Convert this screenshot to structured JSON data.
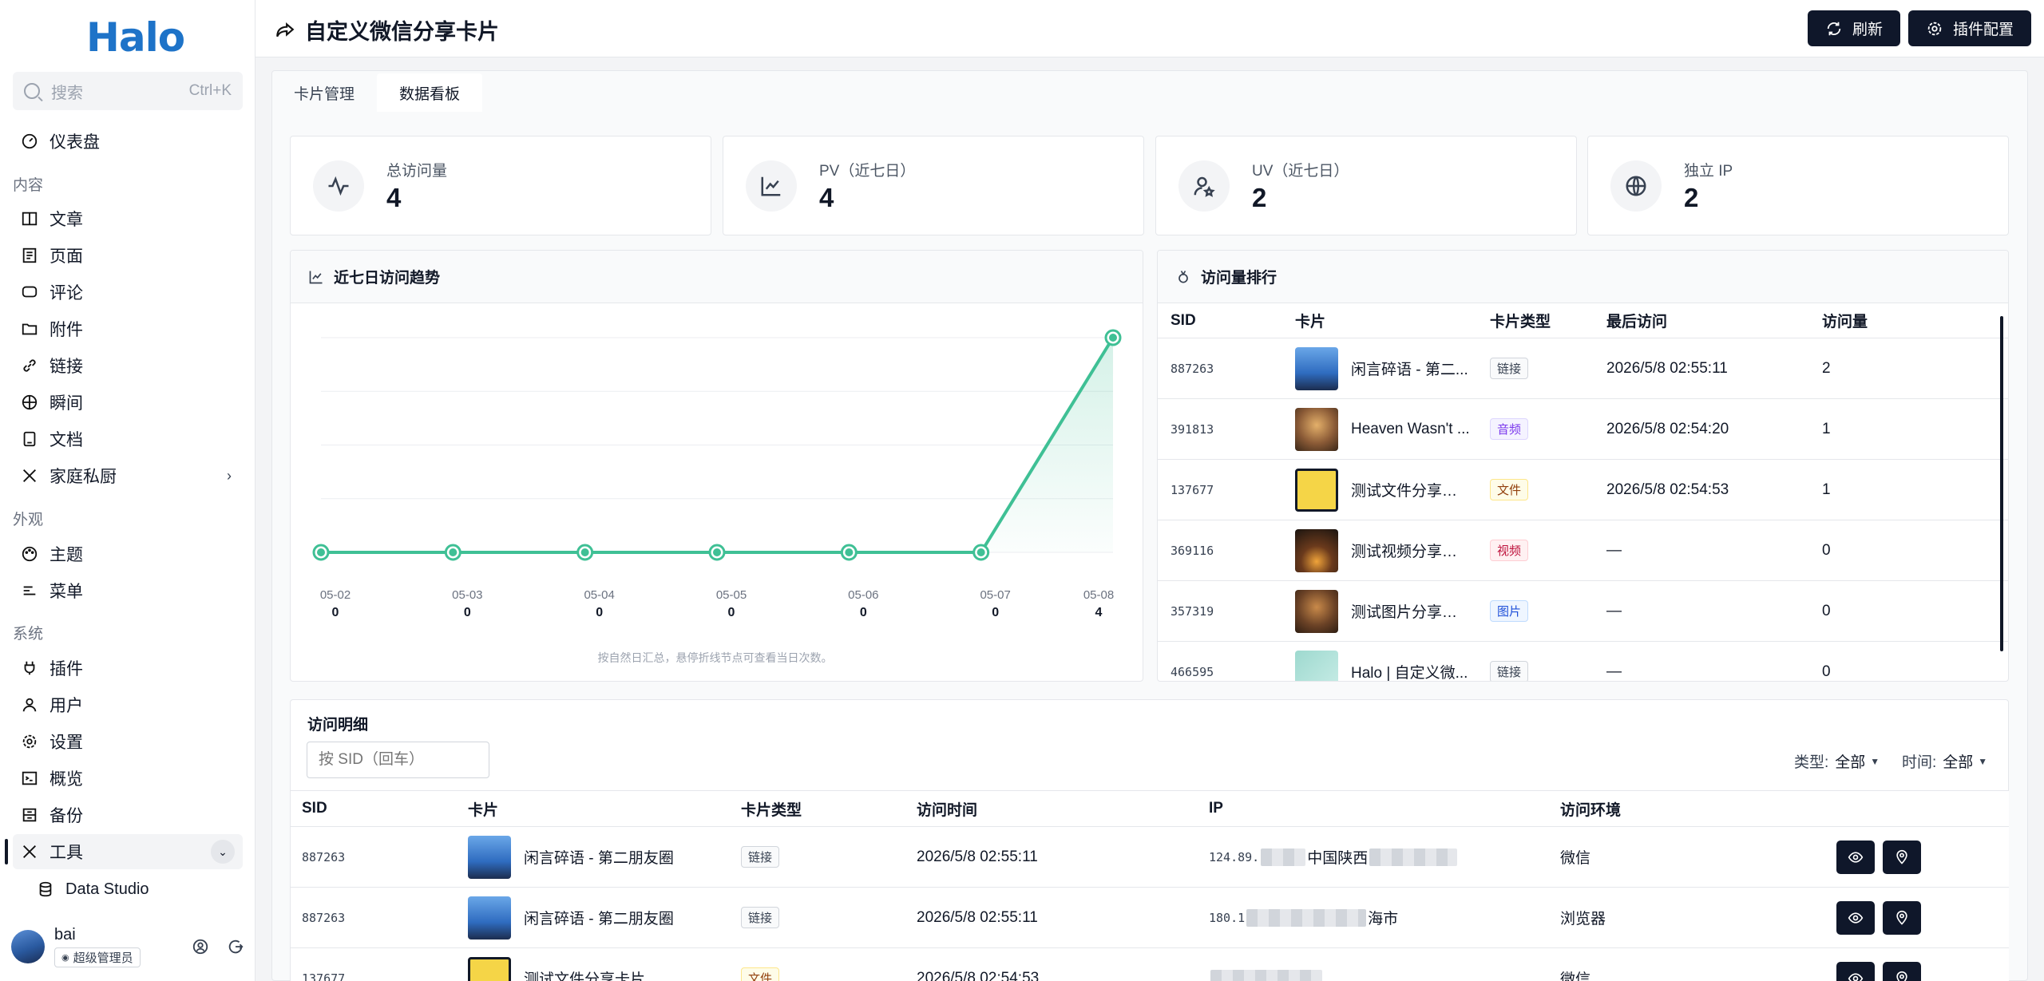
{
  "sidebar": {
    "logo": "Halo",
    "search": {
      "placeholder": "搜索",
      "shortcut": "Ctrl+K"
    },
    "dashboard": "仪表盘",
    "group_content": "内容",
    "posts": "文章",
    "pages": "页面",
    "comments": "评论",
    "attachments": "附件",
    "links": "链接",
    "moments": "瞬间",
    "docs": "文档",
    "kitchen": "家庭私厨",
    "group_appearance": "外观",
    "themes": "主题",
    "menus": "菜单",
    "group_system": "系统",
    "plugins": "插件",
    "users": "用户",
    "settings": "设置",
    "overview": "概览",
    "backup": "备份",
    "tools": "工具",
    "data_studio": "Data Studio",
    "user": {
      "name": "bai",
      "role": "超级管理员"
    }
  },
  "header": {
    "title": "自定义微信分享卡片",
    "refresh": "刷新",
    "plugin_config": "插件配置"
  },
  "tabs": {
    "manage": "卡片管理",
    "dashboard": "数据看板"
  },
  "stats": [
    {
      "label": "总访问量",
      "value": "4",
      "icon": "activity-icon"
    },
    {
      "label": "PV（近七日）",
      "value": "4",
      "icon": "line-chart-icon"
    },
    {
      "label": "UV（近七日）",
      "value": "2",
      "icon": "user-star-icon"
    },
    {
      "label": "独立 IP",
      "value": "2",
      "icon": "globe-icon"
    }
  ],
  "trend": {
    "title": "近七日访问趋势",
    "note": "按自然日汇总，悬停折线节点可查看当日次数。",
    "accent": "#3fc095"
  },
  "chart_data": {
    "type": "area",
    "categories": [
      "05-02",
      "05-03",
      "05-04",
      "05-05",
      "05-06",
      "05-07",
      "05-08"
    ],
    "values": [
      0,
      0,
      0,
      0,
      0,
      0,
      4
    ],
    "ylim": [
      0,
      4
    ],
    "grid": true,
    "color": "#3fc095"
  },
  "ranking": {
    "title": "访问量排行",
    "headers": [
      "SID",
      "卡片",
      "卡片类型",
      "最后访问",
      "访问量"
    ],
    "rows": [
      {
        "sid": "887263",
        "card": "闲言碎语 - 第二...",
        "type": "链接",
        "last": "2026/5/8 02:55:11",
        "count": "2"
      },
      {
        "sid": "391813",
        "card": "Heaven Wasn't ...",
        "type": "音频",
        "last": "2026/5/8 02:54:20",
        "count": "1"
      },
      {
        "sid": "137677",
        "card": "测试文件分享卡片",
        "type": "文件",
        "last": "2026/5/8 02:54:53",
        "count": "1"
      },
      {
        "sid": "369116",
        "card": "测试视频分享卡片",
        "type": "视频",
        "last": "—",
        "count": "0"
      },
      {
        "sid": "357319",
        "card": "测试图片分享卡片",
        "type": "图片",
        "last": "—",
        "count": "0"
      },
      {
        "sid": "466595",
        "card": "Halo | 自定义微...",
        "type": "链接",
        "last": "—",
        "count": "0"
      }
    ]
  },
  "detail": {
    "title": "访问明细",
    "sid_placeholder": "按 SID（回车）",
    "type_filter_label": "类型:",
    "type_filter_value": "全部",
    "time_filter_label": "时间:",
    "time_filter_value": "全部",
    "headers": [
      "SID",
      "卡片",
      "卡片类型",
      "访问时间",
      "IP",
      "访问环境"
    ],
    "rows": [
      {
        "sid": "887263",
        "card": "闲言碎语 - 第二朋友圈",
        "type": "链接",
        "time": "2026/5/8 02:55:11",
        "ip_prefix": "124.89.",
        "ip_suffix": "中国陕西",
        "env": "微信"
      },
      {
        "sid": "887263",
        "card": "闲言碎语 - 第二朋友圈",
        "type": "链接",
        "time": "2026/5/8 02:55:11",
        "ip_prefix": "180.1",
        "ip_suffix": "海市",
        "env": "浏览器"
      },
      {
        "sid": "137677",
        "card": "测试文件分享卡片",
        "type": "文件",
        "time": "2026/5/8 02:54:53",
        "ip_prefix": "",
        "ip_suffix": "",
        "env": "微信"
      }
    ]
  }
}
